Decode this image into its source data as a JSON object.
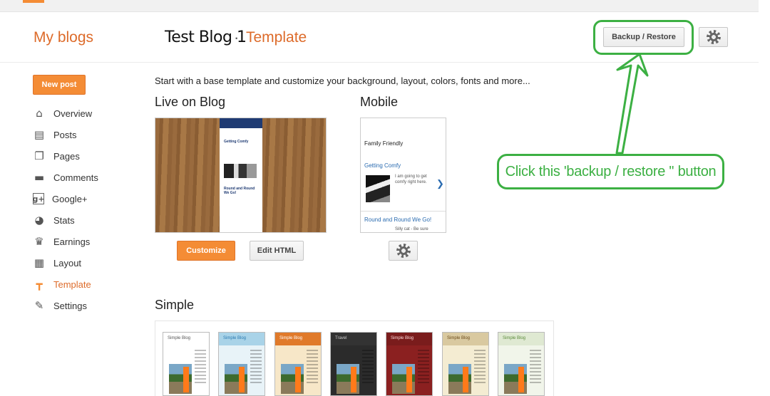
{
  "header": {
    "my_blogs": "My blogs",
    "blog_title": "Test Blog 1",
    "separator": "·",
    "page_title": "Template",
    "backup_restore_label": "Backup / Restore",
    "settings_icon": "gear-icon"
  },
  "sidebar": {
    "new_post_label": "New post",
    "items": [
      {
        "label": "Overview",
        "icon": "home-icon"
      },
      {
        "label": "Posts",
        "icon": "posts-icon"
      },
      {
        "label": "Pages",
        "icon": "pages-icon"
      },
      {
        "label": "Comments",
        "icon": "comment-icon"
      },
      {
        "label": "Google+",
        "icon": "google-plus-icon"
      },
      {
        "label": "Stats",
        "icon": "pie-chart-icon"
      },
      {
        "label": "Earnings",
        "icon": "trophy-icon"
      },
      {
        "label": "Layout",
        "icon": "layout-icon"
      },
      {
        "label": "Template",
        "icon": "paint-roller-icon",
        "active": true
      },
      {
        "label": "Settings",
        "icon": "wrench-icon"
      }
    ]
  },
  "main": {
    "intro": "Start with a base template and customize your background, layout, colors, fonts and more...",
    "live_heading": "Live on Blog",
    "mobile_heading": "Mobile",
    "simple_heading": "Simple",
    "customize_label": "Customize",
    "edit_html_label": "Edit HTML",
    "live_preview": {
      "post1": "Getting Comfy",
      "post2": "Round and Round We Go!"
    },
    "mobile_preview": {
      "blog_name": "Family Friendly",
      "post1_title": "Getting Comfy",
      "post1_snippet": "I am going to get comfy right here.",
      "post2_title": "Round and Round We Go!",
      "post2_snippet": "Silly cat - Be sure"
    },
    "simple_thumbnails": [
      {
        "title": "Simple Blog",
        "header_color": "#ffffff",
        "bg": "#ffffff",
        "text_color": "#555555"
      },
      {
        "title": "Simple Blog",
        "header_color": "#a9d3e8",
        "bg": "#e8f3f8",
        "text_color": "#2a7ab0"
      },
      {
        "title": "Simple Blog",
        "header_color": "#e07a2a",
        "bg": "#f7e7c8",
        "text_color": "#ffffff"
      },
      {
        "title": "Travel",
        "header_color": "#333333",
        "bg": "#2b2b2b",
        "text_color": "#cccccc"
      },
      {
        "title": "Simple Blog",
        "header_color": "#7a1c1c",
        "bg": "#8b2020",
        "text_color": "#ffdddd"
      },
      {
        "title": "Simple Blog",
        "header_color": "#d9c9a0",
        "bg": "#f4ecd2",
        "text_color": "#6b4a1a"
      },
      {
        "title": "Simple Blog",
        "header_color": "#dfe9d2",
        "bg": "#f1f5ea",
        "text_color": "#5a8a3a"
      }
    ]
  },
  "annotation": {
    "text": "Click this 'backup / restore '' button",
    "color": "#3cb043"
  },
  "colors": {
    "accent": "#dd6b2a",
    "button_orange": "#f48c35"
  }
}
